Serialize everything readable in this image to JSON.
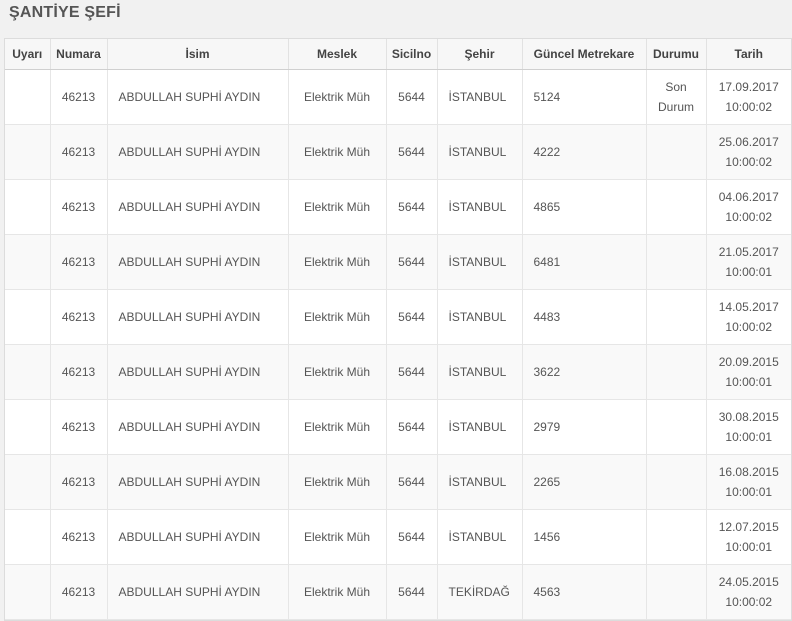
{
  "page": {
    "title": "ŞANTİYE ŞEFİ"
  },
  "table": {
    "columns": [
      "Uyarı",
      "Numara",
      "İsim",
      "Meslek",
      "Sicilno",
      "Şehir",
      "Güncel Metrekare",
      "Durumu",
      "Tarih"
    ],
    "rows": [
      {
        "uyari": "",
        "numara": "46213",
        "isim": "ABDULLAH SUPHİ AYDIN",
        "meslek": "Elektrik Müh",
        "sicilno": "5644",
        "sehir": "İSTANBUL",
        "metrekare": "5124",
        "durum_1": "Son",
        "durum_2": "Durum",
        "tarih_1": "17.09.2017",
        "tarih_2": "10:00:02"
      },
      {
        "uyari": "",
        "numara": "46213",
        "isim": "ABDULLAH SUPHİ AYDIN",
        "meslek": "Elektrik Müh",
        "sicilno": "5644",
        "sehir": "İSTANBUL",
        "metrekare": "4222",
        "durum_1": "",
        "durum_2": "",
        "tarih_1": "25.06.2017",
        "tarih_2": "10:00:02"
      },
      {
        "uyari": "",
        "numara": "46213",
        "isim": "ABDULLAH SUPHİ AYDIN",
        "meslek": "Elektrik Müh",
        "sicilno": "5644",
        "sehir": "İSTANBUL",
        "metrekare": "4865",
        "durum_1": "",
        "durum_2": "",
        "tarih_1": "04.06.2017",
        "tarih_2": "10:00:02"
      },
      {
        "uyari": "",
        "numara": "46213",
        "isim": "ABDULLAH SUPHİ AYDIN",
        "meslek": "Elektrik Müh",
        "sicilno": "5644",
        "sehir": "İSTANBUL",
        "metrekare": "6481",
        "durum_1": "",
        "durum_2": "",
        "tarih_1": "21.05.2017",
        "tarih_2": "10:00:01"
      },
      {
        "uyari": "",
        "numara": "46213",
        "isim": "ABDULLAH SUPHİ AYDIN",
        "meslek": "Elektrik Müh",
        "sicilno": "5644",
        "sehir": "İSTANBUL",
        "metrekare": "4483",
        "durum_1": "",
        "durum_2": "",
        "tarih_1": "14.05.2017",
        "tarih_2": "10:00:02"
      },
      {
        "uyari": "",
        "numara": "46213",
        "isim": "ABDULLAH SUPHİ AYDIN",
        "meslek": "Elektrik Müh",
        "sicilno": "5644",
        "sehir": "İSTANBUL",
        "metrekare": "3622",
        "durum_1": "",
        "durum_2": "",
        "tarih_1": "20.09.2015",
        "tarih_2": "10:00:01"
      },
      {
        "uyari": "",
        "numara": "46213",
        "isim": "ABDULLAH SUPHİ AYDIN",
        "meslek": "Elektrik Müh",
        "sicilno": "5644",
        "sehir": "İSTANBUL",
        "metrekare": "2979",
        "durum_1": "",
        "durum_2": "",
        "tarih_1": "30.08.2015",
        "tarih_2": "10:00:01"
      },
      {
        "uyari": "",
        "numara": "46213",
        "isim": "ABDULLAH SUPHİ AYDIN",
        "meslek": "Elektrik Müh",
        "sicilno": "5644",
        "sehir": "İSTANBUL",
        "metrekare": "2265",
        "durum_1": "",
        "durum_2": "",
        "tarih_1": "16.08.2015",
        "tarih_2": "10:00:01"
      },
      {
        "uyari": "",
        "numara": "46213",
        "isim": "ABDULLAH SUPHİ AYDIN",
        "meslek": "Elektrik Müh",
        "sicilno": "5644",
        "sehir": "İSTANBUL",
        "metrekare": "1456",
        "durum_1": "",
        "durum_2": "",
        "tarih_1": "12.07.2015",
        "tarih_2": "10:00:01"
      },
      {
        "uyari": "",
        "numara": "46213",
        "isim": "ABDULLAH SUPHİ AYDIN",
        "meslek": "Elektrik Müh",
        "sicilno": "5644",
        "sehir": "TEKİRDAĞ",
        "metrekare": "4563",
        "durum_1": "",
        "durum_2": "",
        "tarih_1": "24.05.2015",
        "tarih_2": "10:00:02"
      }
    ]
  }
}
